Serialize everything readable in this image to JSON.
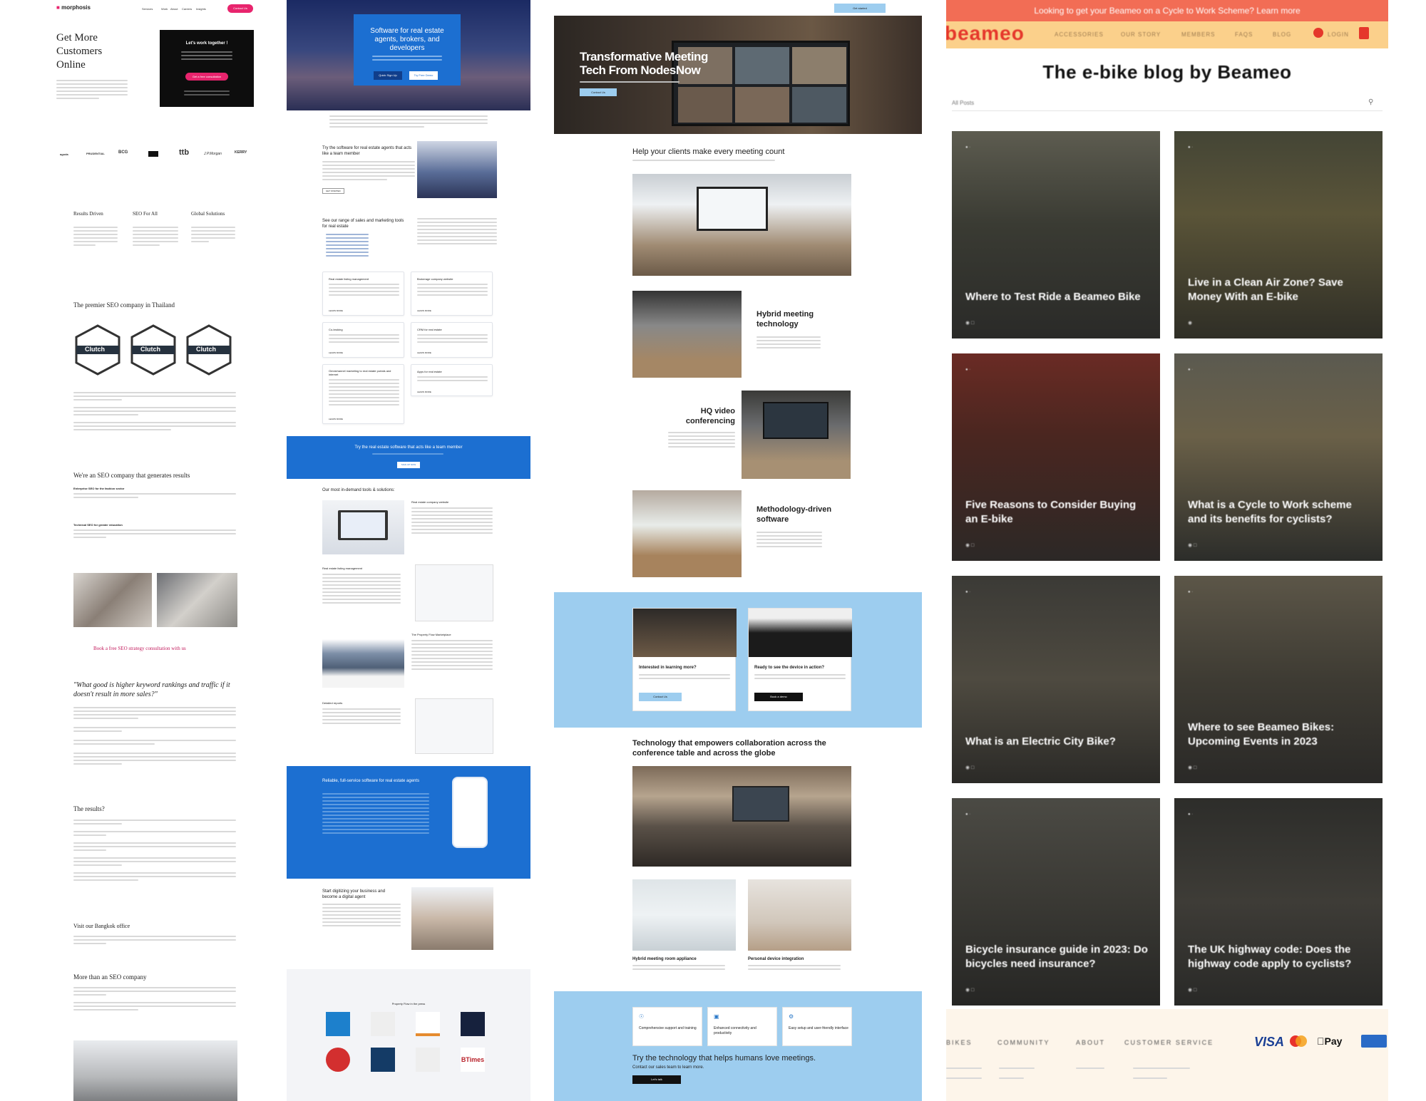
{
  "c1": {
    "brand": "morphosis",
    "nav": [
      "Services",
      "Work",
      "About",
      "Careers",
      "Insights"
    ],
    "contact": "Contact Us",
    "hero": [
      "Get More",
      "Customers",
      "Online"
    ],
    "lwt": "Let's work together !",
    "consult": "Get a free consultation",
    "logos": [
      "agoda",
      "PRUDENTIAL",
      "BCG",
      "",
      "ttb",
      "J.P.Morgan",
      "KERRY"
    ],
    "f1": "Results Driven",
    "f2": "SEO For All",
    "f3": "Global Solutions",
    "premier": "The premier SEO company in Thailand",
    "clutch": "Clutch",
    "generates": "We're an SEO company that generates results",
    "ent": "Enterprise SEO for the fashion sector",
    "tech": "Technical SEO for greater education",
    "book": "Book a free SEO strategy consultation with us",
    "quote": "\"What good is higher keyword rankings and traffic if it doesn't result in more sales?\"",
    "results": "The results?",
    "bangkok": "Visit our Bangkok office",
    "more": "More than an SEO company"
  },
  "c2": {
    "hero": "Software for real estate agents, brokers, and developers",
    "signup": "Quick Sign Up",
    "demo": "Try Free Demo",
    "try1": "Try the software for real estate agents that acts like a team member",
    "getstarted": "GET STARTED",
    "range": "See our range of sales and marketing tools for real estate",
    "cards": [
      "Real estate listing management",
      "Brokerage company website",
      "Co-broking",
      "CRM for real estate",
      "Omnichannel marketing to real estate portals and internet",
      "Apps for real estate"
    ],
    "learn": "LEARN MORE",
    "band": "Try the real estate software that acts like a team member",
    "signupnow": "SIGN UP NOW",
    "tools": "Our most in-demand tools & solutions:",
    "tools_items": [
      "Real estate company website",
      "Real estate listing management",
      "The Property Flow Marketplace",
      "Detailed reports"
    ],
    "reliable": "Reliable, full-service software for real estate agents",
    "digitize": "Start digitizing your business and become a digital agent",
    "press": "Property Flow in the press"
  },
  "c3": {
    "getstarted": "Get started",
    "hero": "Transformative Meeting Tech From NodesNow",
    "help": "Help your clients make every meeting count",
    "hybrid": "Hybrid meeting technology",
    "hq": "HQ video conferencing",
    "method": "Methodology-driven software",
    "interested": "Interested in learning more?",
    "ready": "Ready to see the device in action?",
    "contact": "Contact Us",
    "bookdemo": "Book a demo",
    "tech": "Technology that empowers collaboration across the conference table and across the globe",
    "hma": "Hybrid meeting room appliance",
    "pdi": "Personal device integration",
    "f1": "Comprehensive support and training",
    "f2": "Enhanced connectivity and productivity",
    "f3": "Easy setup and user-friendly interface",
    "try": "Try the technology that helps humans love meetings.",
    "sales": "Contact our sales team to learn more.",
    "talk": "Let's talk"
  },
  "c4": {
    "banner": "Looking to get your Beameo on a Cycle to Work Scheme? Learn more",
    "logo": "beameo",
    "nav": [
      "ACCESSORIES",
      "OUR STORY",
      "MEMBERS",
      "FAQS",
      "BLOG",
      "LOGIN"
    ],
    "title": "The e-bike blog by Beameo",
    "allposts": "All Posts",
    "posts": [
      {
        "t": "Where to Test Ride a Beameo Bike"
      },
      {
        "t": "Live in a Clean Air Zone? Save Money With an E-bike"
      },
      {
        "t": "Five Reasons to Consider Buying an E-bike"
      },
      {
        "t": "What is a Cycle to Work scheme and its benefits for cyclists?"
      },
      {
        "t": "What is an Electric City Bike?"
      },
      {
        "t": "Where to see Beameo Bikes: Upcoming Events in 2023"
      },
      {
        "t": "Bicycle insurance guide in 2023: Do bicycles need insurance?"
      },
      {
        "t": "The UK highway code: Does the highway code apply to cyclists?"
      }
    ],
    "footer": [
      "BIKES",
      "COMMUNITY",
      "ABOUT",
      "CUSTOMER SERVICE"
    ],
    "pay": [
      "VISA",
      "Pay"
    ]
  }
}
